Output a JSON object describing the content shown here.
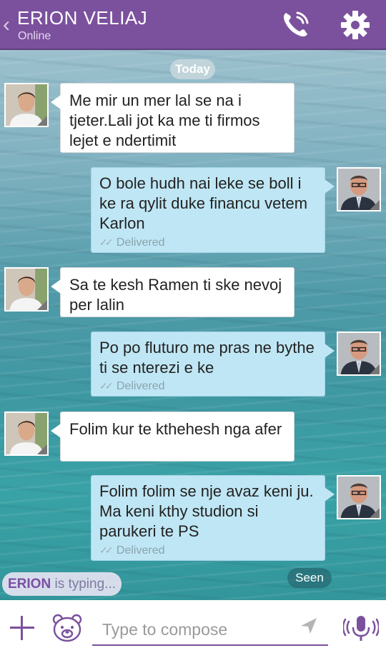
{
  "header": {
    "back_glyph": "‹",
    "contact_name": "ERION VELIAJ",
    "status": "Online",
    "call_icon": "phone-call-icon",
    "settings_icon": "gear-icon",
    "accent_color": "#7b519d"
  },
  "chat": {
    "date_label": "Today",
    "messages": [
      {
        "direction": "incoming",
        "text": "Me mir un mer lal se na i tjeter.Lali jot ka me ti firmos lejet e ndertimit"
      },
      {
        "direction": "outgoing",
        "text": "O bole hudh nai leke se boll i ke ra qylit duke financu vetem Karlon",
        "status": "Delivered"
      },
      {
        "direction": "incoming",
        "text": "Sa te kesh Ramen ti ske nevoj per lalin"
      },
      {
        "direction": "outgoing",
        "text": "Po po fluturo me pras ne bythe ti se nterezi e ke",
        "status": "Delivered"
      },
      {
        "direction": "incoming",
        "text": "Folim kur te kthehesh nga afer"
      },
      {
        "direction": "outgoing",
        "text": "Folim folim se nje avaz keni ju. Ma keni kthy studion si parukeri te PS",
        "status": "Delivered"
      }
    ],
    "typing_name": "ERION",
    "typing_text": " is typing...",
    "seen_label": "Seen"
  },
  "composer": {
    "placeholder": "Type to compose",
    "add_icon": "plus-icon",
    "sticker_icon": "bear-sticker-icon",
    "send_icon": "send-arrow-icon",
    "mic_icon": "microphone-icon"
  }
}
